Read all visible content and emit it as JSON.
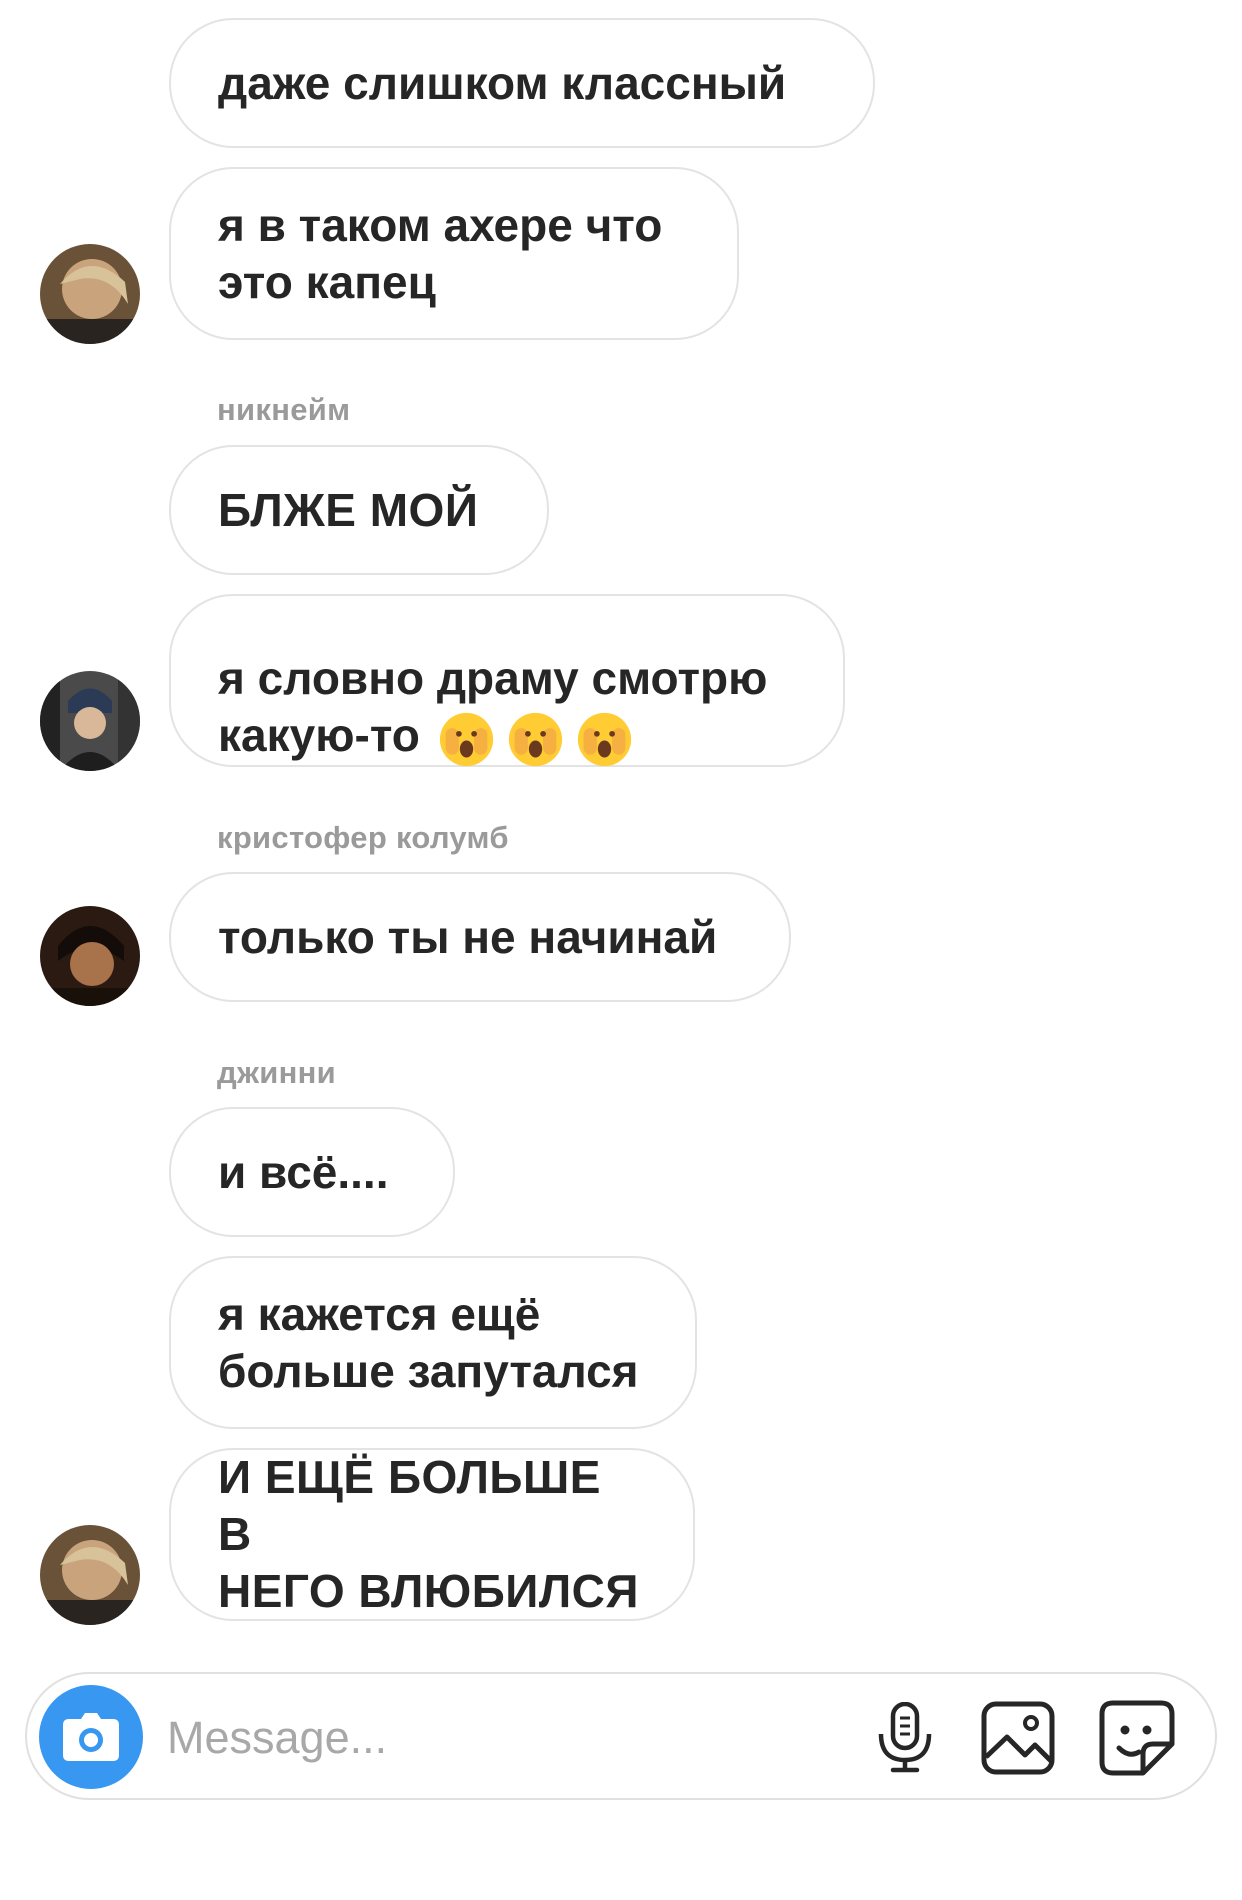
{
  "messages": [
    {
      "text": "даже слишком классный"
    },
    {
      "text": "я в таком ахере что\nэто капец"
    },
    {
      "text": "БЛЖЕ МОЙ"
    },
    {
      "text": "я словно драму смотрю\nкакую-то",
      "emoji": [
        "😱",
        "😱",
        "😱"
      ]
    },
    {
      "text": "только ты не начинай"
    },
    {
      "text": "и всё...."
    },
    {
      "text": "я кажется ещё\nбольше запутался"
    },
    {
      "text": "И ЕЩЁ БОЛЬШЕ В\nНЕГО ВЛЮБИЛСЯ"
    }
  ],
  "senders": [
    "никнейм",
    "кристофер колумб",
    "джинни"
  ],
  "composer": {
    "placeholder": "Message...",
    "icons": [
      "camera-icon",
      "microphone-icon",
      "gallery-icon",
      "sticker-icon"
    ],
    "accent_color": "#3897f0"
  }
}
